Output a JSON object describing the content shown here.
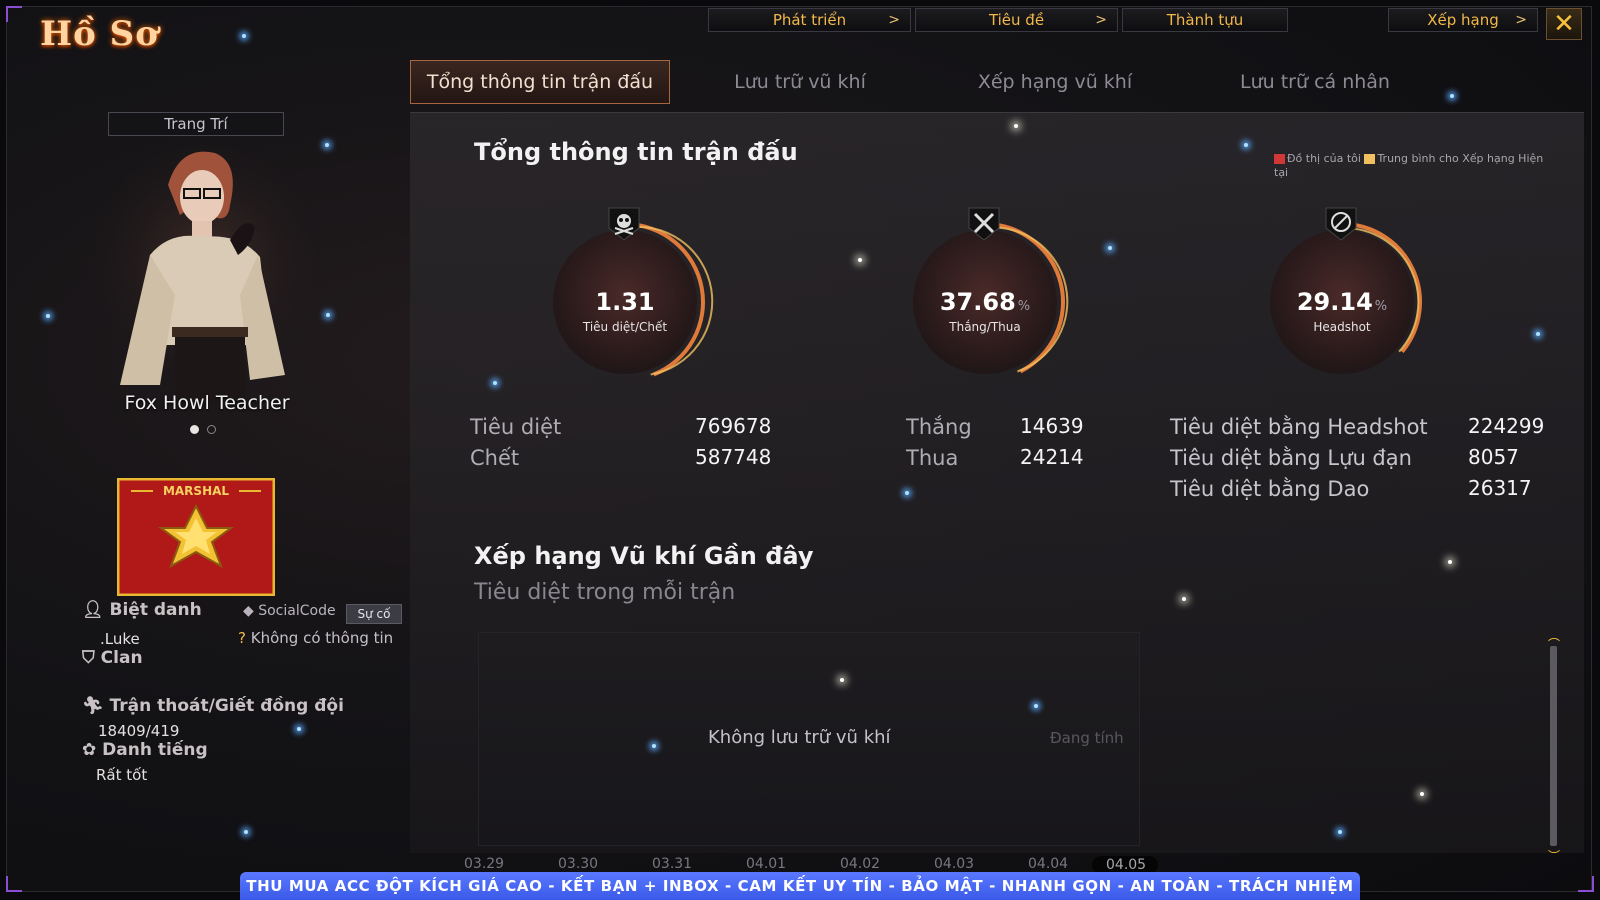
{
  "header": {
    "title": "Hồ Sơ",
    "nav": [
      "Phát triển",
      "Tiêu đề",
      "Thành tựu",
      "Xếp hạng"
    ],
    "nav_arrow": ">",
    "close_label": "✕"
  },
  "subtabs": [
    "Tổng thông tin trận đấu",
    "Lưu trữ vũ khí",
    "Xếp hạng vũ khí",
    "Lưu trữ cá nhân"
  ],
  "profile": {
    "decor_label": "Trang Trí",
    "character_name": "Fox Howl Teacher",
    "rank_label": "MARSHAL",
    "nickname_label": "Biệt danh",
    "nickname_value": ".Luke",
    "socialcode_label": "SocialCode",
    "incident_button": "Sự cố",
    "no_info": "Không có thông tin",
    "clan_label": "Clan",
    "escape_label": "Trận thoát/Giết đồng đội",
    "escape_value": "18409/419",
    "reputation_label": "Danh tiếng",
    "reputation_value": "Rất tốt"
  },
  "overview": {
    "title": "Tổng thông tin trận đấu",
    "legend_mine": "Đồ thị của tôi",
    "legend_avg": "Trung bình cho Xếp hạng Hiện tại",
    "legend_colors": {
      "mine": "#d03838",
      "avg": "#f0c060"
    },
    "gauges": [
      {
        "value": "1.31",
        "label": "Tiêu diệt/Chết",
        "unit": "",
        "fill": 0.88,
        "icon": "skull-icon"
      },
      {
        "value": "37.68",
        "label": "Thắng/Thua",
        "unit": "%",
        "fill": 0.85,
        "icon": "crossed-swords-icon"
      },
      {
        "value": "29.14",
        "label": "Headshot",
        "unit": "%",
        "fill": 0.72,
        "icon": "no-gun-icon"
      }
    ],
    "kd": {
      "kills_label": "Tiêu diệt",
      "kills": "769678",
      "deaths_label": "Chết",
      "deaths": "587748"
    },
    "wl": {
      "wins_label": "Thắng",
      "wins": "14639",
      "losses_label": "Thua",
      "losses": "24214"
    },
    "hs": {
      "headshot_label": "Tiêu diệt bằng Headshot",
      "headshot": "224299",
      "grenade_label": "Tiêu diệt bằng Lựu đạn",
      "grenade": "8057",
      "knife_label": "Tiêu diệt bằng Dao",
      "knife": "26317"
    }
  },
  "weapon_ranking": {
    "title": "Xếp hạng Vũ khí Gần đây",
    "subtitle": "Tiêu diệt trong mỗi trận",
    "empty_text": "Không lưu trữ vũ khí",
    "status_text": "Đang tính",
    "dates": [
      "03.29",
      "03.30",
      "03.31",
      "04.01",
      "04.02",
      "04.03",
      "04.04",
      "04.05"
    ]
  },
  "banner": "THU MUA ACC ĐỘT KÍCH GIÁ CAO  -  KẾT BẠN + INBOX  -  CAM KẾT UY TÍN - BẢO MẬT - NHANH GỌN - AN TOÀN - TRÁCH NHIỆM",
  "colors": {
    "accent": "#f2b84a",
    "panel": "#2a272b",
    "banner": "#4a66f0",
    "gauge_ring": "#e07a3a"
  }
}
